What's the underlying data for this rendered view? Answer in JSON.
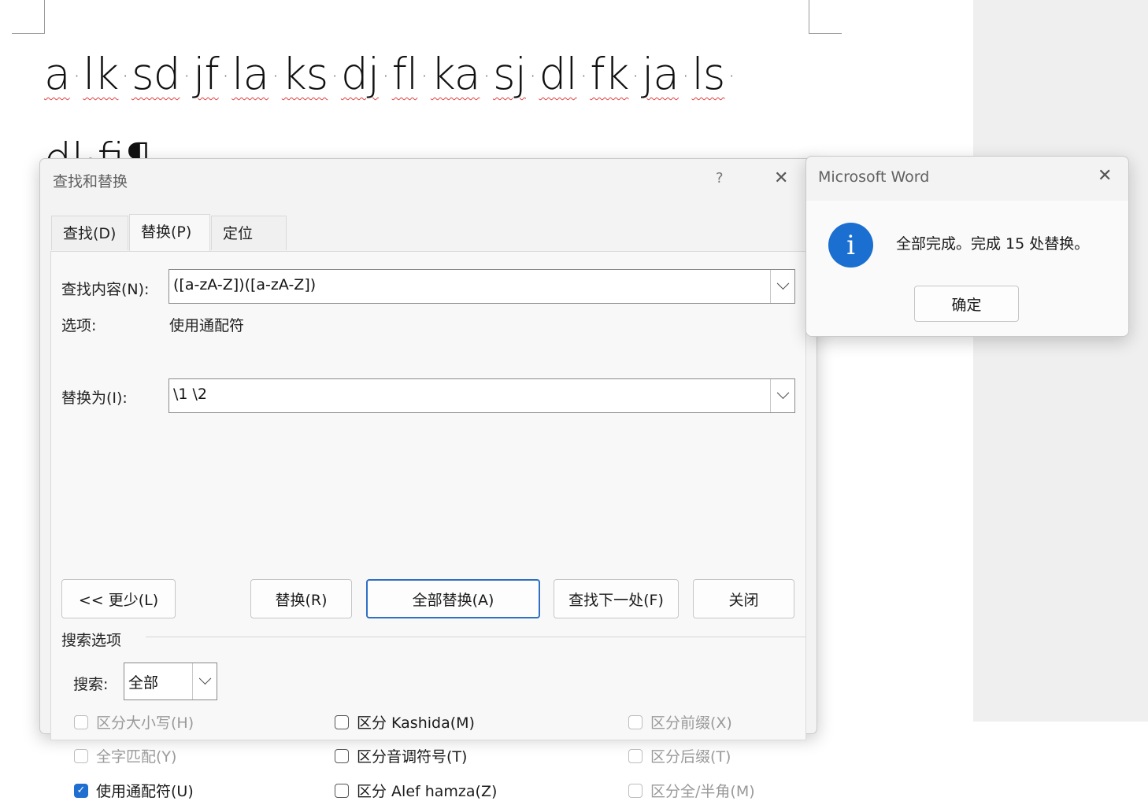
{
  "document": {
    "words": [
      "a",
      "lk",
      "sd",
      "jf",
      "la",
      "ks",
      "dj",
      "fl",
      "ka",
      "sj",
      "dl",
      "fk",
      "ja",
      "ls"
    ],
    "separator": "·",
    "line2": "dl·fi¶"
  },
  "find_replace": {
    "title": "查找和替换",
    "help": "?",
    "close": "✕",
    "tabs": [
      "查找(D)",
      "替换(P)",
      "定位(G)"
    ],
    "find_label": "查找内容(N):",
    "find_value": "([a-zA-Z])([a-zA-Z])",
    "options_label": "选项:",
    "options_value": "使用通配符",
    "replace_label": "替换为(I):",
    "replace_value": "\\1 \\2",
    "buttons": {
      "less": "<< 更少(L)",
      "replace": "替换(R)",
      "replace_all": "全部替换(A)",
      "find_next": "查找下一处(F)",
      "close": "关闭"
    },
    "search_options_title": "搜索选项",
    "search_label": "搜索:",
    "search_value": "全部",
    "checkboxes": {
      "col1": [
        {
          "label": "区分大小写(H)",
          "checked": false,
          "disabled": true
        },
        {
          "label": "全字匹配(Y)",
          "checked": false,
          "disabled": true
        },
        {
          "label": "使用通配符(U)",
          "checked": true,
          "disabled": false
        }
      ],
      "col2": [
        {
          "label": "区分 Kashida(M)",
          "checked": false,
          "disabled": false
        },
        {
          "label": "区分音调符号(T)",
          "checked": false,
          "disabled": false
        },
        {
          "label": "区分 Alef hamza(Z)",
          "checked": false,
          "disabled": false
        }
      ],
      "col3": [
        {
          "label": "区分前缀(X)",
          "checked": false,
          "disabled": true
        },
        {
          "label": "区分后缀(T)",
          "checked": false,
          "disabled": true
        },
        {
          "label": "区分全/半角(M)",
          "checked": false,
          "disabled": true
        }
      ]
    }
  },
  "message_box": {
    "title": "Microsoft Word",
    "close": "✕",
    "icon": "i",
    "text": "全部完成。完成 15 处替换。",
    "ok": "确定"
  }
}
